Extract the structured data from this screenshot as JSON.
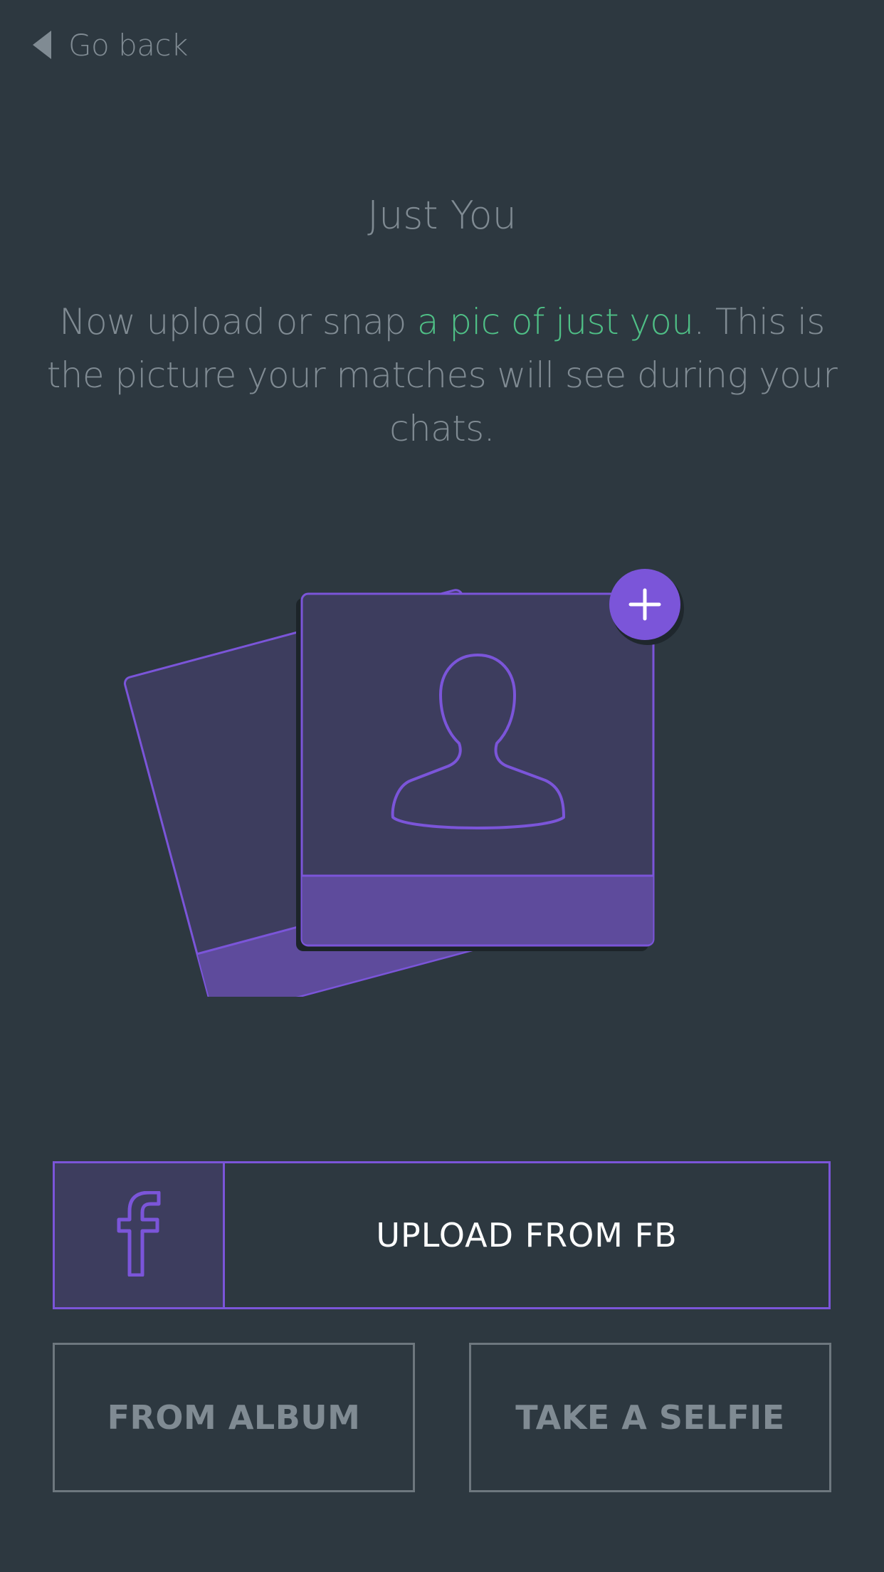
{
  "nav": {
    "back_label": "Go back",
    "back_icon": "caret-left-icon"
  },
  "header": {
    "title": "Just You"
  },
  "description": {
    "before": "Now upload or snap ",
    "highlight": "a pic of just you",
    "after": ". This is the picture your matches will see during your chats."
  },
  "illustration": {
    "icons": [
      "photo-stack-icon",
      "person-silhouette-icon",
      "plus-icon"
    ]
  },
  "actions": {
    "fb_label": "UPLOAD FROM FB",
    "fb_icon": "facebook-icon",
    "album_label": "FROM ALBUM",
    "selfie_label": "TAKE A SELFIE"
  },
  "colors": {
    "background": "#2d3840",
    "text_muted": "#808b93",
    "highlight": "#4fbf86",
    "accent": "#7b55d9",
    "card_fill": "#3d3d5e",
    "card_band": "#5e4b9c"
  }
}
